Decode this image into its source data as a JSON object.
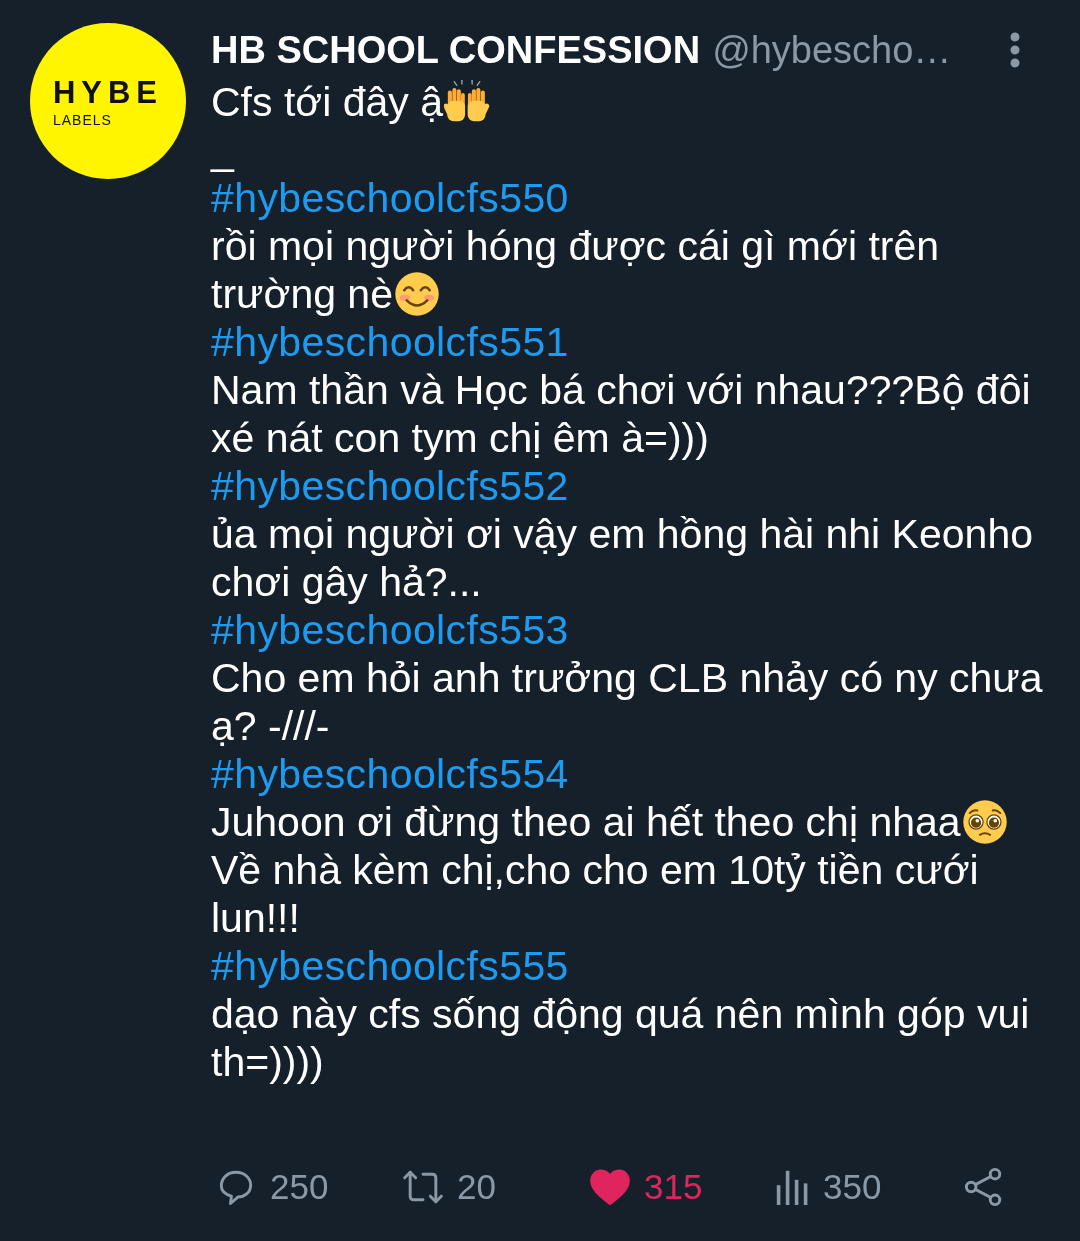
{
  "author": {
    "avatar": {
      "logo_text": "HYBE",
      "logo_subtext": "LABELS"
    },
    "name": "HB SCHOOL CONFESSION",
    "handle": "@hybescho…"
  },
  "intro": {
    "text": "Cfs tới đây ậ",
    "kind": "hands"
  },
  "separator": "_",
  "confessions": [
    {
      "hashtag": "#hybeschoolcfs550",
      "text": "rồi mọi người hóng được cái gì mới trên trường nè",
      "kind": "smiling"
    },
    {
      "hashtag": "#hybeschoolcfs551",
      "text": "Nam thần và Học bá chơi với nhau???Bộ đôi xé nát con tym chị êm à=)))",
      "kind": "plain"
    },
    {
      "hashtag": "#hybeschoolcfs552",
      "text": "ủa mọi người ơi vậy em hồng hài nhi Keonho chơi gây hả?...",
      "kind": "plain"
    },
    {
      "hashtag": "#hybeschoolcfs553",
      "text": "Cho em hỏi anh trưởng CLB nhảy có ny chưa ạ? -///-",
      "kind": "plain"
    },
    {
      "hashtag": "#hybeschoolcfs554",
      "text": "Juhoon ơi đừng theo ai hết theo chị nhaa",
      "kind": "pleading",
      "continuation": "Về nhà kèm chị,cho cho em 10tỷ tiền cưới lun!!!"
    },
    {
      "hashtag": "#hybeschoolcfs555",
      "text": "dạo này cfs sống động quá nên mình góp vui th=))))",
      "kind": "plain"
    }
  ],
  "actions": [
    {
      "kind": "reply",
      "count": "250",
      "active": false
    },
    {
      "kind": "retweet",
      "count": "20",
      "active": false
    },
    {
      "kind": "like",
      "count": "315",
      "active": true
    },
    {
      "kind": "views",
      "count": "350",
      "active": false
    },
    {
      "kind": "share",
      "active": false
    }
  ]
}
